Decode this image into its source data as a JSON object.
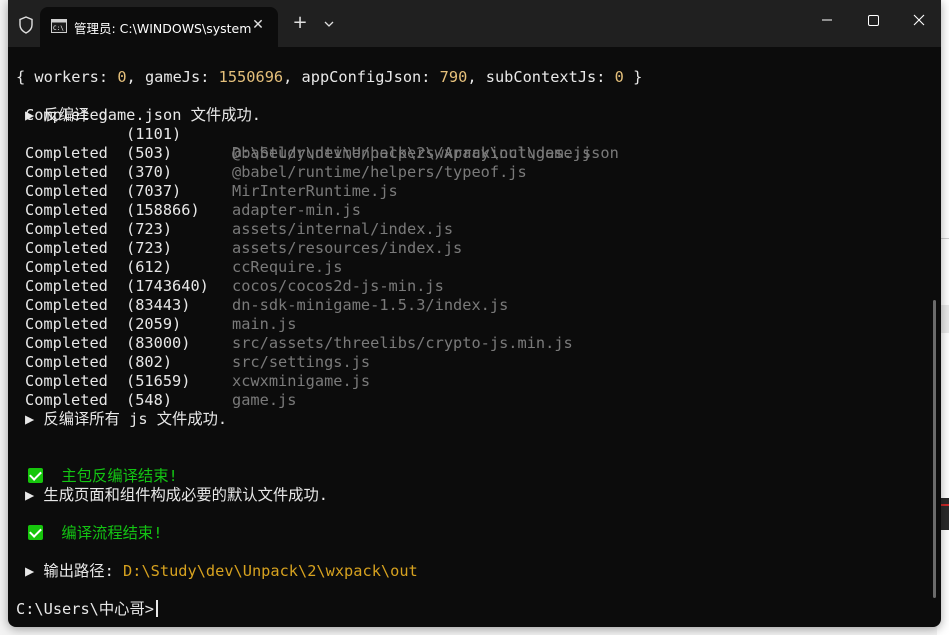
{
  "window": {
    "tab_title": "管理员: C:\\WINDOWS\\system",
    "tab_close": "✕",
    "new_tab": "+"
  },
  "terminal": {
    "stats_line": {
      "open": "{ ",
      "workers_key": "workers: ",
      "workers_val": "0",
      "gamejs_key": ", gameJs: ",
      "gamejs_val": "1550696",
      "appconfig_key": ", appConfigJson: ",
      "appconfig_val": "790",
      "subcontext_key": ", subContextJs: ",
      "subcontext_val": "0",
      "close": " }"
    },
    "game_json": {
      "status": "Completed",
      "count": "(1101)",
      "path": "D:\\Study\\dev\\Unpack\\2\\wxpack\\out\\game.json"
    },
    "game_json_msg": "▶ 反编译 game.json 文件成功.",
    "files": [
      {
        "status": "Completed",
        "count": "(503)",
        "path": "@babel/runtime/helpers/Arrayincludes.js"
      },
      {
        "status": "Completed",
        "count": "(370)",
        "path": "@babel/runtime/helpers/typeof.js"
      },
      {
        "status": "Completed",
        "count": "(7037)",
        "path": "MirInterRuntime.js"
      },
      {
        "status": "Completed",
        "count": "(158866)",
        "path": "adapter-min.js"
      },
      {
        "status": "Completed",
        "count": "(723)",
        "path": "assets/internal/index.js"
      },
      {
        "status": "Completed",
        "count": "(723)",
        "path": "assets/resources/index.js"
      },
      {
        "status": "Completed",
        "count": "(612)",
        "path": "ccRequire.js"
      },
      {
        "status": "Completed",
        "count": "(1743640)",
        "path": "cocos/cocos2d-js-min.js"
      },
      {
        "status": "Completed",
        "count": "(83443)",
        "path": "dn-sdk-minigame-1.5.3/index.js"
      },
      {
        "status": "Completed",
        "count": "(2059)",
        "path": "main.js"
      },
      {
        "status": "Completed",
        "count": "(83000)",
        "path": "src/assets/threelibs/crypto-js.min.js"
      },
      {
        "status": "Completed",
        "count": "(802)",
        "path": "src/settings.js"
      },
      {
        "status": "Completed",
        "count": "(51659)",
        "path": "xcwxminigame.js"
      },
      {
        "status": "Completed",
        "count": "(548)",
        "path": "game.js"
      }
    ],
    "js_msg": "▶ 反编译所有 js 文件成功.",
    "main_pkg_done": "主包反编译结束!",
    "page_files_msg": "▶ 生成页面和组件构成必要的默认文件成功.",
    "compile_done": "编译流程结束!",
    "output_label": "▶ 输出路径: ",
    "output_path": "D:\\Study\\dev\\Unpack\\2\\wxpack\\out",
    "prompt": "C:\\Users\\中心哥>"
  },
  "colors": {
    "terminal_bg": "#0c0c0c",
    "titlebar_bg": "#202020",
    "number": "#e5c07b",
    "success_green": "#13c413",
    "path_yellow": "#d7a21f",
    "path_gray": "#7a7a7a"
  },
  "icons": {
    "shield": "shield-icon",
    "tab": "terminal-tab-icon",
    "check": "check-icon"
  }
}
